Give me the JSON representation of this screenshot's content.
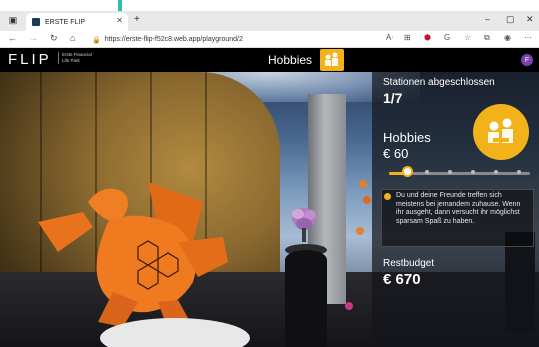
{
  "browser": {
    "tab_title": "ERSTE FLIP",
    "new_tab": "+",
    "url": "https://erste-flip-f52c8.web.app/playground/2",
    "window_controls": [
      "–",
      "▢",
      "✕"
    ]
  },
  "header": {
    "logo": "FLIP",
    "logo_sub_1": "Erste Financial",
    "logo_sub_2": "Life Park",
    "title": "Hobbies",
    "avatar_letter": "F"
  },
  "panel": {
    "stations_label": "Stationen abgeschlossen",
    "stations_value": "1/7",
    "category_label": "Hobbies",
    "category_amount": "€ 60",
    "slider_value": 0.13,
    "description": "Du und deine Freunde treffen sich meistens bei jemandem zuhause. Wenn ihr ausgeht, dann versucht ihr möglichst sparsam Spaß zu haben.",
    "budget_label": "Restbudget",
    "budget_value": "€ 670"
  },
  "colors": {
    "accent": "#f4b21a",
    "avatar": "#7b3fb0",
    "panel_bg": "#14161c"
  }
}
